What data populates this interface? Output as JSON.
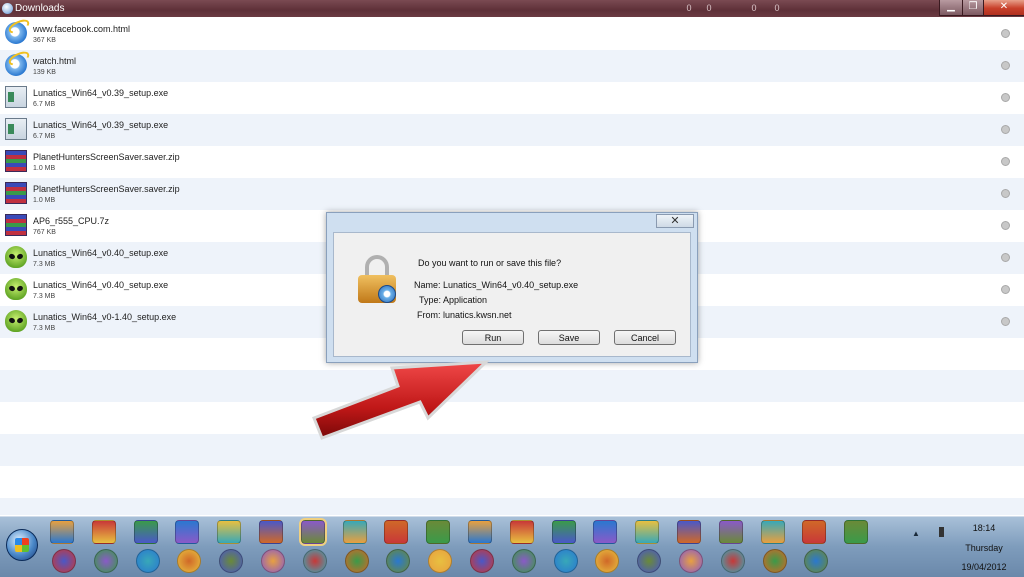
{
  "window": {
    "title": "Downloads",
    "titlebar_items": [
      "0",
      "0",
      "0",
      "0"
    ],
    "min_glyph": "▁",
    "max_glyph": "❐",
    "close_glyph": "✕"
  },
  "downloads": [
    {
      "name": "www.facebook.com.html",
      "size": "367 KB",
      "icon": "ie-html-icon"
    },
    {
      "name": "watch.html",
      "size": "139 KB",
      "icon": "ie-html-icon"
    },
    {
      "name": "Lunatics_Win64_v0.39_setup.exe",
      "size": "6.7 MB",
      "icon": "exe-icon"
    },
    {
      "name": "Lunatics_Win64_v0.39_setup.exe",
      "size": "6.7 MB",
      "icon": "exe-icon"
    },
    {
      "name": "PlanetHuntersScreenSaver.saver.zip",
      "size": "1.0 MB",
      "icon": "winrar-icon"
    },
    {
      "name": "PlanetHuntersScreenSaver.saver.zip",
      "size": "1.0 MB",
      "icon": "winrar-icon"
    },
    {
      "name": "AP6_r555_CPU.7z",
      "size": "767 KB",
      "icon": "winrar-icon"
    },
    {
      "name": "Lunatics_Win64_v0.40_setup.exe",
      "size": "7.3 MB",
      "icon": "alien-icon"
    },
    {
      "name": "Lunatics_Win64_v0.40_setup.exe",
      "size": "7.3 MB",
      "icon": "alien-icon"
    },
    {
      "name": "Lunatics_Win64_v0-1.40_setup.exe",
      "size": "7.3 MB",
      "icon": "alien-icon"
    }
  ],
  "dialog": {
    "close_glyph": "✕",
    "question": "Do you want to run or save this file?",
    "name_label": "Name:",
    "name_value": "Lunatics_Win64_v0.40_setup.exe",
    "type_label": "Type:",
    "type_value": "Application",
    "from_label": "From:",
    "from_value": "lunatics.kwsn.net",
    "run_label": "Run",
    "save_label": "Save",
    "cancel_label": "Cancel"
  },
  "taskbar": {
    "clock_time": "18:14",
    "clock_day": "Thursday",
    "clock_date": "19/04/2012",
    "tray_arrow": "▲",
    "top_row_icons": [
      "media-player-icon",
      "compass-app-icon",
      "windows-orb-icon",
      "ie-icon",
      "chrome-icon",
      "ie-icon",
      "safari-icon",
      "earth-icon",
      "satellite-icon",
      "figure-icon",
      "b4-icon",
      "road-icon",
      "app-box-icon",
      "photoshop-icon",
      "bridge-icon",
      "people-icon",
      "folder-icon",
      "firefox-icon",
      "picasa-icon",
      "pen-icon"
    ],
    "bottom_row_icons": [
      "grid-app-icon",
      "clock-app-icon",
      "disc-app-icon",
      "jb-icon",
      "itunes-icon",
      "network-app-icon",
      "pen-tablet-icon",
      "search-app-icon",
      "help-icon",
      "hp-icon",
      "gear-app-icon",
      "power-app-icon",
      "calc-icon",
      "space-app-icon",
      "map-app-icon",
      "camera-app-icon",
      "nvidia-icon",
      "reel-icon",
      "search-tool-icon"
    ],
    "accent": "#7e9cbc"
  }
}
